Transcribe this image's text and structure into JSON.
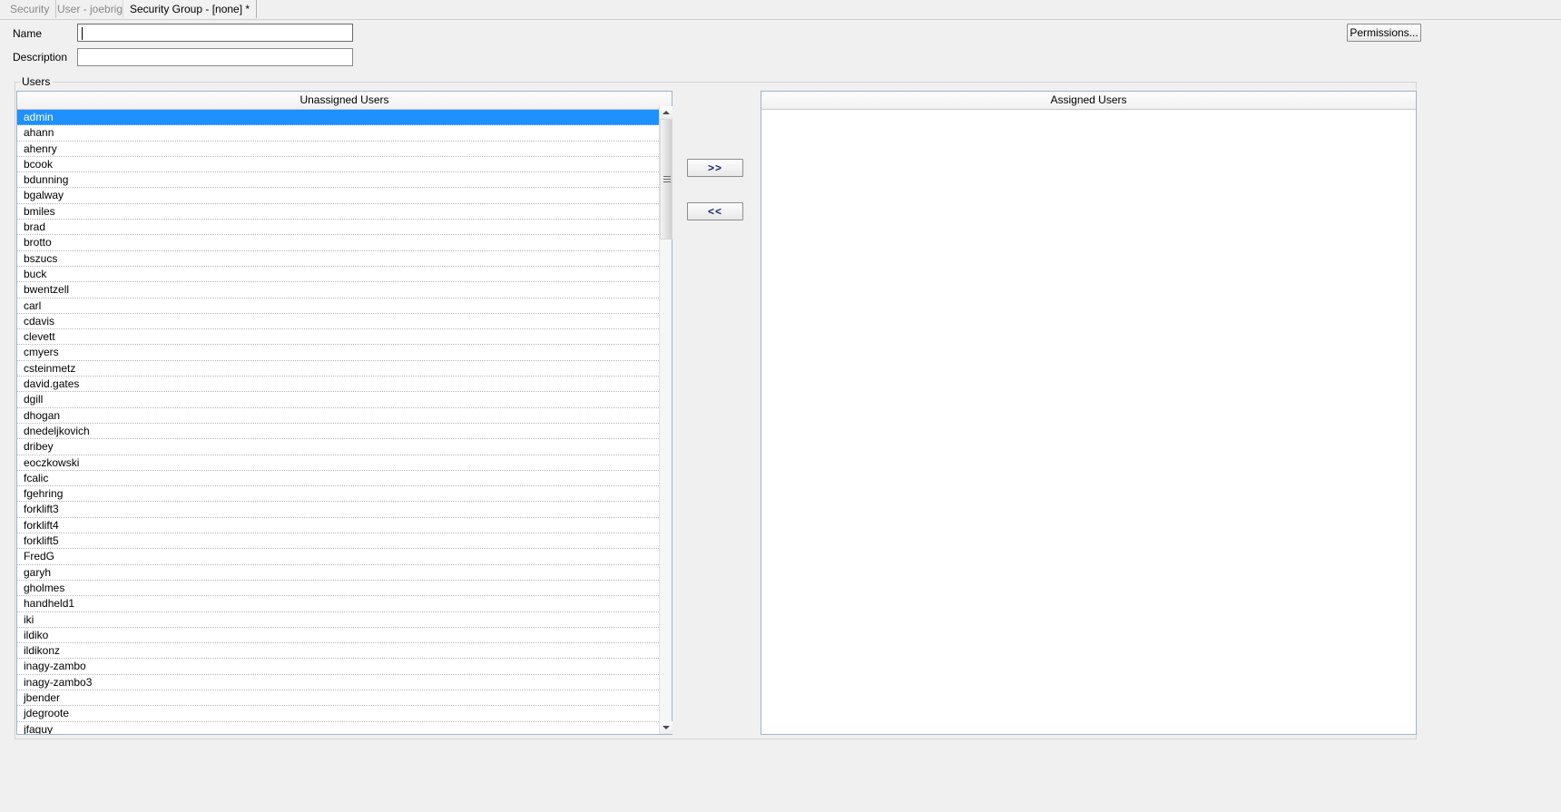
{
  "tabs": [
    {
      "label": "Security",
      "active": false
    },
    {
      "label": "User - joebright",
      "active": false
    },
    {
      "label": "Security Group - [none] *",
      "active": true
    }
  ],
  "form": {
    "name_label": "Name",
    "name_value": "",
    "name_placeholder": "",
    "description_label": "Description",
    "description_value": "",
    "description_placeholder": ""
  },
  "toolbar": {
    "permissions_label": "Permissions..."
  },
  "users_group": {
    "legend": "Users",
    "unassigned_header": "Unassigned Users",
    "assigned_header": "Assigned Users",
    "assign_label": ">>",
    "unassign_label": "<<",
    "unassigned_users": [
      "admin",
      "ahann",
      "ahenry",
      "bcook",
      "bdunning",
      "bgalway",
      "bmiles",
      "brad",
      "brotto",
      "bszucs",
      "buck",
      "bwentzell",
      "carl",
      "cdavis",
      "clevett",
      "cmyers",
      "csteinmetz",
      "david.gates",
      "dgill",
      "dhogan",
      "dnedeljkovich",
      "dribey",
      "eoczkowski",
      "fcalic",
      "fgehring",
      "forklift3",
      "forklift4",
      "forklift5",
      "FredG",
      "garyh",
      "gholmes",
      "handheld1",
      "iki",
      "ildiko",
      "ildikonz",
      "inagy-zambo",
      "inagy-zambo3",
      "jbender",
      "jdegroote",
      "jfaguy"
    ],
    "selected_user": "admin",
    "assigned_users": []
  },
  "colors": {
    "selection": "#1e90ff",
    "window_bg": "#f0f0f0",
    "list_bg": "#ffffff",
    "panel_border": "#a0b4c8",
    "inactive_tab_text": "#888888"
  },
  "scrollbar": {
    "up_icon": "triangle-up-icon",
    "down_icon": "triangle-down-icon",
    "grip_icon": "grip-lines-icon"
  }
}
